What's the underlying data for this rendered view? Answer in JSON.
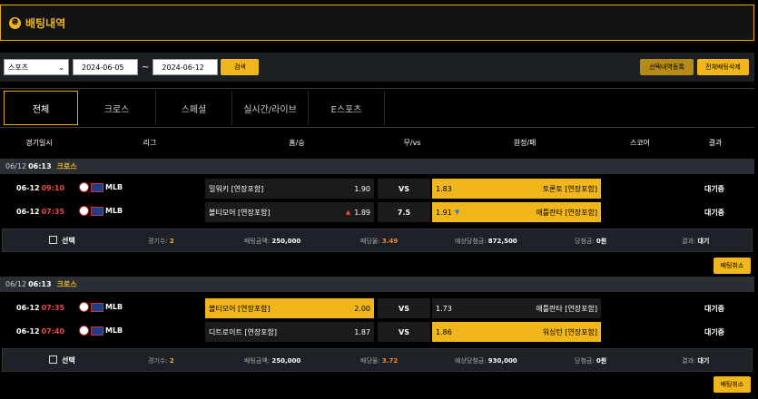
{
  "page": {
    "title": "배팅내역",
    "title_icon": "coin-icon",
    "title_icon_glyph": "₴"
  },
  "filter": {
    "sport_select": "스포츠",
    "date_from": "2024-06-05",
    "date_sep": "~",
    "date_to": "2024-06-12",
    "search_label": "검색",
    "register_selected_label": "선택내역등록",
    "delete_all_label": "전체배팅삭제"
  },
  "tabs": [
    "전체",
    "크로스",
    "스페셜",
    "실시간/라이브",
    "E스포츠"
  ],
  "columns": [
    "경기일시",
    "리그",
    "홈/승",
    "무/vs",
    "원정/패",
    "스코어",
    "결과"
  ],
  "groups": [
    {
      "date": "06/12",
      "time": "06:13",
      "type": "크로스",
      "rows": [
        {
          "date": "06-12",
          "time": "09:10",
          "league": "MLB",
          "home": "밀워키 [연장포함]",
          "home_odds": "1.90",
          "home_arrow": "",
          "home_selected": false,
          "draw": "VS",
          "away_odds": "1.83",
          "away_arrow": "",
          "away": "토론토 [연장포함]",
          "away_selected": true,
          "result": "대기중"
        },
        {
          "date": "06-12",
          "time": "07:35",
          "league": "MLB",
          "home": "볼티모어 [연장포함]",
          "home_odds": "1.89",
          "home_arrow": "▲",
          "home_selected": false,
          "draw": "7.5",
          "away_odds": "1.91",
          "away_arrow": "▼",
          "away": "애틀란타 [연장포함]",
          "away_selected": true,
          "result": "대기중"
        }
      ],
      "summary": {
        "select_label": "선택",
        "count_label": "경기수:",
        "count": "2",
        "bet_label": "배팅금액:",
        "bet": "250,000",
        "rate_label": "배당율:",
        "rate": "3.49",
        "expected_label": "예상당첨금:",
        "expected": "872,500",
        "won_label": "당첨금:",
        "won": "0원",
        "result_label": "결과:",
        "result": "대기"
      },
      "cancel_label": "배팅취소"
    },
    {
      "date": "06/12",
      "time": "06:13",
      "type": "크로스",
      "rows": [
        {
          "date": "06-12",
          "time": "07:35",
          "league": "MLB",
          "home": "볼티모어 [연장포함]",
          "home_odds": "2.00",
          "home_arrow": "",
          "home_selected": true,
          "draw": "VS",
          "away_odds": "1.73",
          "away_arrow": "",
          "away": "애틀란타 [연장포함]",
          "away_selected": false,
          "result": "대기중"
        },
        {
          "date": "06-12",
          "time": "07:40",
          "league": "MLB",
          "home": "디트로이트 [연장포함]",
          "home_odds": "1.87",
          "home_arrow": "",
          "home_selected": false,
          "draw": "VS",
          "away_odds": "1.86",
          "away_arrow": "",
          "away": "워싱턴 [연장포함]",
          "away_selected": true,
          "result": "대기중"
        }
      ],
      "summary": {
        "select_label": "선택",
        "count_label": "경기수:",
        "count": "2",
        "bet_label": "배팅금액:",
        "bet": "250,000",
        "rate_label": "배당율:",
        "rate": "3.72",
        "expected_label": "예상당첨금:",
        "expected": "930,000",
        "won_label": "당첨금:",
        "won": "0원",
        "result_label": "결과:",
        "result": "대기"
      },
      "cancel_label": "배팅취소"
    }
  ],
  "colors": {
    "accent": "#f1b61b",
    "time_red": "#f04646",
    "odds_orange": "#f58a2a",
    "panel": "#1c1f24"
  }
}
